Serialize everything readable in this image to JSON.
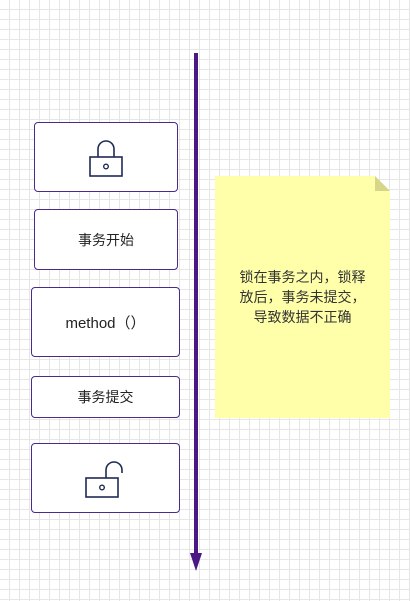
{
  "diagram": {
    "steps": [
      {
        "kind": "icon",
        "icon": "lock-closed-icon"
      },
      {
        "kind": "text",
        "label": "事务开始"
      },
      {
        "kind": "text",
        "label": "method（）"
      },
      {
        "kind": "text",
        "label": "事务提交"
      },
      {
        "kind": "icon",
        "icon": "lock-open-icon"
      }
    ],
    "note": {
      "lines": [
        "锁在事务之内，锁释",
        "放后，事务未提交，",
        "导致数据不正确"
      ]
    },
    "colors": {
      "border": "#4b2a8a",
      "arrow": "#4b1785",
      "note_fill": "#ffffaa",
      "grid": "#e6e6e6"
    }
  }
}
